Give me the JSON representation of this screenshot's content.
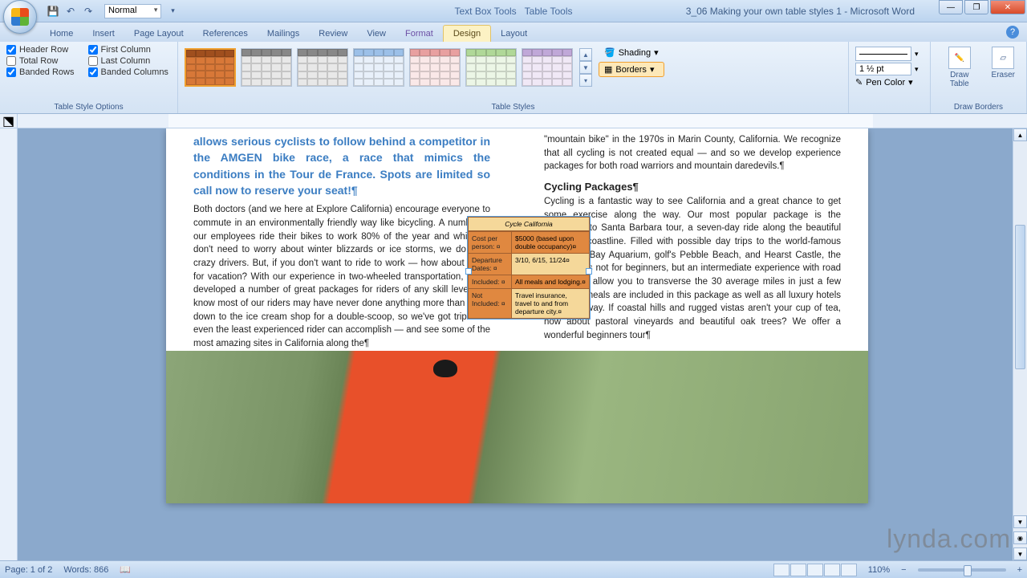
{
  "titlebar": {
    "style_selector": "Normal",
    "context_tool_1": "Text Box Tools",
    "context_tool_2": "Table Tools",
    "doc_title": "3_06 Making your own table styles 1 - Microsoft Word"
  },
  "tabs": {
    "home": "Home",
    "insert": "Insert",
    "page_layout": "Page Layout",
    "references": "References",
    "mailings": "Mailings",
    "review": "Review",
    "view": "View",
    "format": "Format",
    "design": "Design",
    "layout": "Layout"
  },
  "ribbon": {
    "tso": {
      "header_row": "Header Row",
      "first_column": "First Column",
      "total_row": "Total Row",
      "last_column": "Last Column",
      "banded_rows": "Banded Rows",
      "banded_columns": "Banded Columns",
      "group_label": "Table Style Options",
      "checks": {
        "header_row": true,
        "first_column": true,
        "total_row": false,
        "last_column": false,
        "banded_rows": true,
        "banded_columns": true
      }
    },
    "styles": {
      "group_label": "Table Styles",
      "shading": "Shading",
      "borders": "Borders"
    },
    "pen": {
      "weight": "1 ½ pt",
      "pen_color": "Pen Color"
    },
    "draw": {
      "draw_table": "Draw Table",
      "eraser": "Eraser",
      "group_label": "Draw Borders"
    }
  },
  "document": {
    "blue_heading": "allows serious cyclists to follow behind a competitor in the AMGEN bike race, a race that mimics the conditions in the Tour de France. Spots are limited so call now to reserve your seat!¶",
    "col1_body": "Both doctors (and we here at Explore California) encourage everyone to commute in an environmentally friendly way like bicycling. A number of our employees ride their bikes to work 80% of the year and while we don't need to worry about winter blizzards or ice storms, we do have crazy drivers. But, if you don't want to ride to work — how about riding for vacation? With our experience in two-wheeled transportation, we've developed a number of great packages for riders of any skill level. We know most of our riders may have never done anything more than riding down to the ice cream shop for a double-scoop, so we've got trips that even the least experienced rider can accomplish — and see some of the most amazing sites in California along the¶",
    "col2_top": "\"mountain bike\" in the 1970s in Marin County, California. We recognize that all cycling is not created equal — and so we develop experience packages for both road warriors and mountain daredevils.¶",
    "packages_heading": "Cycling Packages¶",
    "col2_body": "Cycling is a fantastic way to see California and a great chance to get some exercise along the way. Our most popular package is the Monterrey to Santa Barbara tour, a seven-day ride along the beautiful California coastline. Filled with possible day trips to the world-famous Monterrey Bay Aquarium, golf's Pebble Beach, and Hearst Castle, the MSB tour is not for beginners, but an intermediate experience with road cycling will allow you to transverse the 30 average miles in just a few hours. All meals are included in this package as well as all luxury hotels along the way. If coastal hills and rugged vistas aren't your cup of tea, how about pastoral vineyards and beautiful oak trees? We offer a wonderful beginners tour¶",
    "table": {
      "title": "Cycle California",
      "rows": [
        {
          "label": "Cost per person: ¤",
          "value": "$5000 (based upon double occupancy)¤"
        },
        {
          "label": "Departure Dates: ¤",
          "value": "3/10, 6/15, 11/24¤"
        },
        {
          "label": "Included: ¤",
          "value": "All meals and lodging.¤"
        },
        {
          "label": "Not Included: ¤",
          "value": "Travel insurance, travel to and from departure city.¤"
        }
      ]
    }
  },
  "statusbar": {
    "page": "Page: 1 of 2",
    "words": "Words: 866",
    "zoom": "110%"
  },
  "watermark": "lynda.com"
}
